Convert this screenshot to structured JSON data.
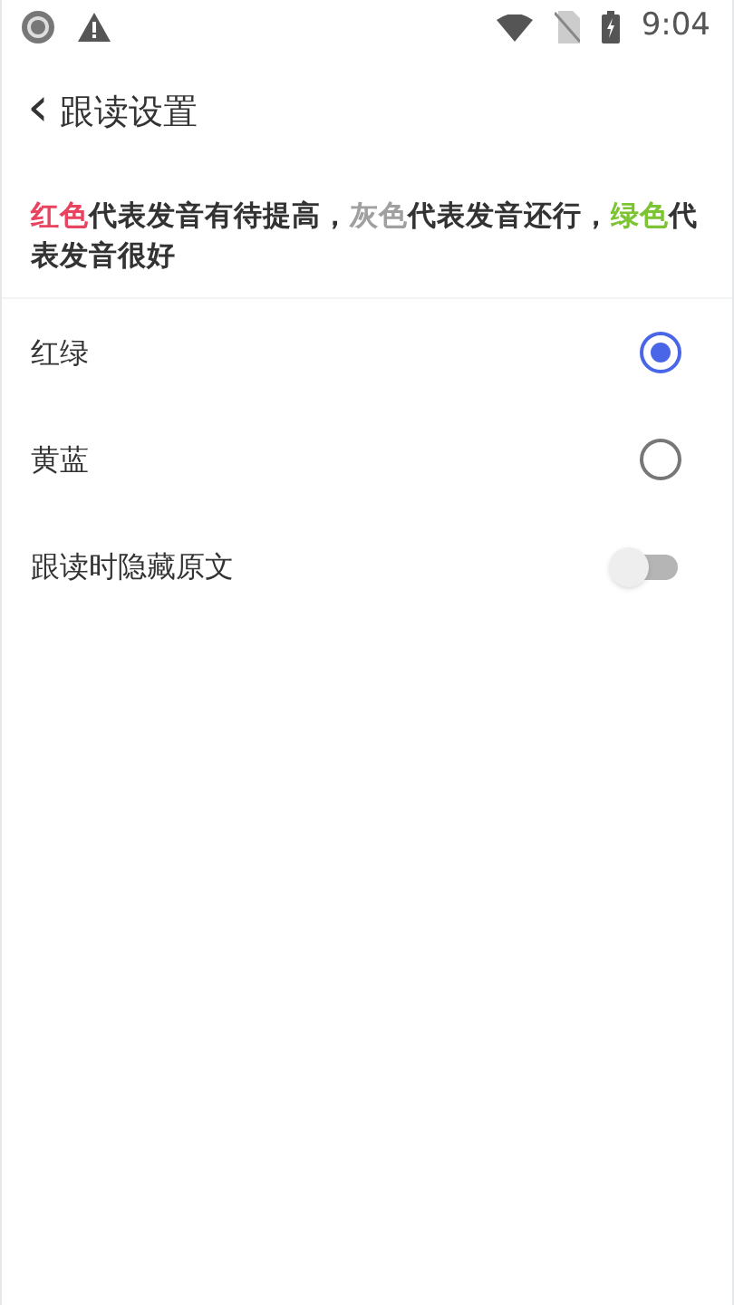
{
  "status_bar": {
    "time": "9:04"
  },
  "header": {
    "back": "‹",
    "title": "跟读设置"
  },
  "legend": [
    {
      "text": "红色",
      "color": "#e8445f"
    },
    {
      "text": "代表发音有待提高，",
      "color": "#333333"
    },
    {
      "text": "灰色",
      "color": "#a0a0a0"
    },
    {
      "text": "代表发音还行，",
      "color": "#333333"
    },
    {
      "text": "绿色",
      "color": "#7cc434"
    },
    {
      "text": "代表发音很好",
      "color": "#333333"
    }
  ],
  "options": [
    {
      "kind": "radio",
      "label": "红绿",
      "selected": true
    },
    {
      "kind": "radio",
      "label": "黄蓝",
      "selected": false
    },
    {
      "kind": "switch",
      "label": "跟读时隐藏原文",
      "on": false
    }
  ]
}
